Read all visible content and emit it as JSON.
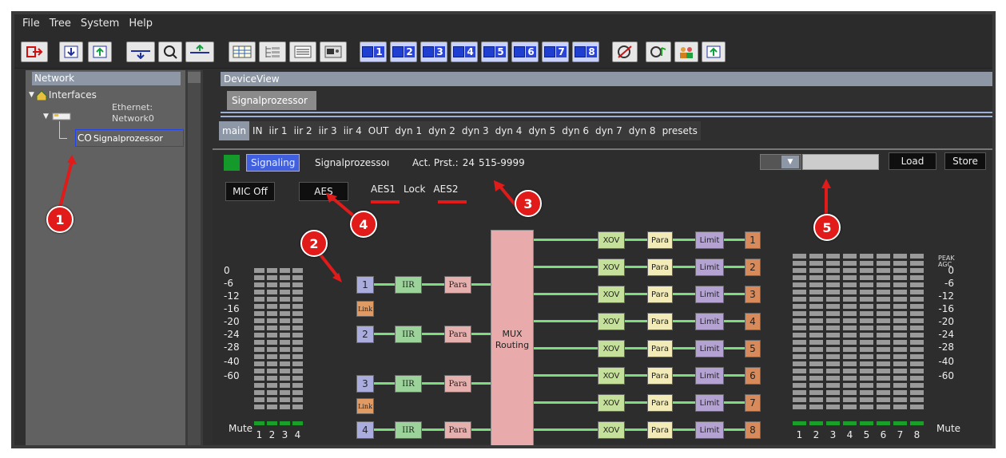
{
  "menu": [
    "File",
    "Tree",
    "System",
    "Help"
  ],
  "network": {
    "header": "Network",
    "tree": {
      "interfaces": "Interfaces",
      "ethernet_line1": "Ethernet:",
      "ethernet_line2": "Network0",
      "node_prefix": "CO",
      "node_label": "Signalprozessor"
    }
  },
  "device": {
    "header": "DeviceView",
    "subtab": "Signalprozessor",
    "tabs": [
      "main",
      "IN",
      "iir 1",
      "iir 2",
      "iir 3",
      "iir 4",
      "OUT",
      "dyn 1",
      "dyn 2",
      "dyn 3",
      "dyn 4",
      "dyn 5",
      "dyn 6",
      "dyn 7",
      "dyn 8",
      "presets"
    ],
    "active_tab": "main"
  },
  "status": {
    "signaling": "Signaling",
    "device_name": "Signalprozessoı",
    "act_prst_label": "Act. Prst.:",
    "act_prst_value": "24",
    "serial": "515-9999",
    "load": "Load",
    "store": "Store"
  },
  "controls": {
    "mic_off": "MIC Off",
    "aes": "AES",
    "aes1": "AES1",
    "lock": "Lock",
    "aes2": "AES2"
  },
  "input_meter": {
    "scale": [
      "0",
      "-6",
      "-12",
      "-16",
      "-20",
      "-24",
      "-28",
      "-40",
      "-60"
    ],
    "mute": "Mute",
    "channels": [
      "1",
      "2",
      "3",
      "4"
    ]
  },
  "output_meter": {
    "scale": [
      "0",
      "-6",
      "-12",
      "-16",
      "-20",
      "-24",
      "-28",
      "-40",
      "-60"
    ],
    "peak": "PEAK",
    "agc": "AGC",
    "mute": "Mute",
    "channels": [
      "1",
      "2",
      "3",
      "4",
      "5",
      "6",
      "7",
      "8"
    ]
  },
  "inputs": [
    {
      "num": "1",
      "iir": "IIR",
      "para": "Para"
    },
    {
      "num": "2",
      "iir": "IIR",
      "para": "Para"
    },
    {
      "num": "3",
      "iir": "IIR",
      "para": "Para"
    },
    {
      "num": "4",
      "iir": "IIR",
      "para": "Para"
    }
  ],
  "link_label": "Link",
  "mux": {
    "line1": "MUX",
    "line2": "Routing"
  },
  "outputs": [
    {
      "num": "1",
      "xov": "XOV",
      "para": "Para",
      "limit": "Limit"
    },
    {
      "num": "2",
      "xov": "XOV",
      "para": "Para",
      "limit": "Limit"
    },
    {
      "num": "3",
      "xov": "XOV",
      "para": "Para",
      "limit": "Limit"
    },
    {
      "num": "4",
      "xov": "XOV",
      "para": "Para",
      "limit": "Limit"
    },
    {
      "num": "5",
      "xov": "XOV",
      "para": "Para",
      "limit": "Limit"
    },
    {
      "num": "6",
      "xov": "XOV",
      "para": "Para",
      "limit": "Limit"
    },
    {
      "num": "7",
      "xov": "XOV",
      "para": "Para",
      "limit": "Limit"
    },
    {
      "num": "8",
      "xov": "XOV",
      "para": "Para",
      "limit": "Limit"
    }
  ],
  "toolbar_presets": [
    "1",
    "2",
    "3",
    "4",
    "5",
    "6",
    "7",
    "8"
  ],
  "callouts": [
    "1",
    "2",
    "3",
    "4",
    "5"
  ],
  "colors": {
    "accent": "#e11a1a",
    "signal_line": "#7ddc7d",
    "panel_header": "#8d97a6"
  }
}
